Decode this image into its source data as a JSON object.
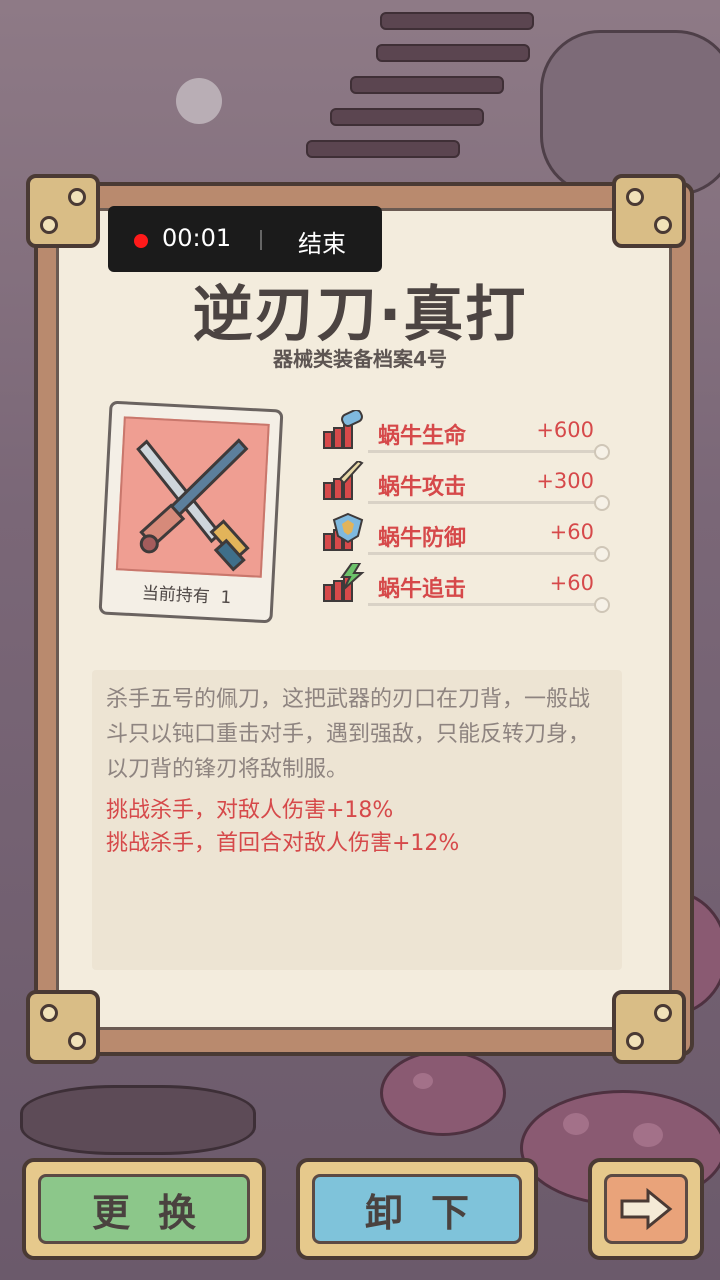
{
  "recording": {
    "time": "00:01",
    "end_label": "结束"
  },
  "item": {
    "name": "逆刃刀·真打",
    "subtitle": "器械类装备档案4号",
    "owned_label": "当前持有",
    "owned_count": "1"
  },
  "stats": [
    {
      "icon": "health-potion-icon",
      "label": "蜗牛生命",
      "value": "+600"
    },
    {
      "icon": "sword-icon",
      "label": "蜗牛攻击",
      "value": "+300"
    },
    {
      "icon": "shield-icon",
      "label": "蜗牛防御",
      "value": "+60"
    },
    {
      "icon": "lightning-icon",
      "label": "蜗牛追击",
      "value": "+60"
    }
  ],
  "description": "杀手五号的佩刀，这把武器的刃口在刀背，一般战斗只以钝口重击对手，遇到强敌，只能反转刀身，以刀背的锋刃将敌制服。",
  "effects": [
    "挑战杀手，对敌人伤害+18%",
    "挑战杀手，首回合对敌人伤害+12%"
  ],
  "buttons": {
    "replace": "更换",
    "unequip": "卸下",
    "next_icon": "arrow-right-icon"
  },
  "colors": {
    "stat_red": "#d6494a",
    "paper": "#f3ecdd",
    "frame": "#b98a6e"
  }
}
